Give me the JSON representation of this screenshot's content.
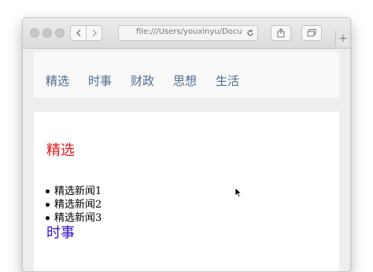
{
  "browser": {
    "address_text": "file:///Users/youxinyu/Docu",
    "back_icon": "chevron-left-icon",
    "forward_icon": "chevron-right-icon",
    "reload_icon": "reload-icon",
    "share_icon": "share-icon",
    "tabs_icon": "tabs-overview-icon",
    "new_tab_icon": "plus-icon"
  },
  "nav": {
    "items": [
      {
        "label": "精选"
      },
      {
        "label": "时事"
      },
      {
        "label": "财政"
      },
      {
        "label": "思想"
      },
      {
        "label": "生活"
      }
    ],
    "color": "#4a6b91"
  },
  "sections": [
    {
      "title": "精选",
      "color": "#e0161c",
      "news": [
        "精选新闻1",
        "精选新闻2",
        "精选新闻3"
      ]
    },
    {
      "title": "时事",
      "color": "#3a14c7",
      "news": []
    }
  ]
}
